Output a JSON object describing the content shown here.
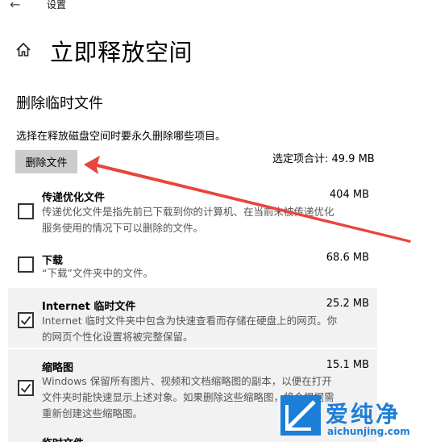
{
  "app": {
    "title": "设置",
    "page_title": "立即释放空间"
  },
  "section": {
    "title": "删除临时文件",
    "description": "选择在释放磁盘空间时要永久删除哪些项目。",
    "delete_button": "删除文件",
    "total_selected": "选定项合计: 49.9 MB"
  },
  "items": [
    {
      "name": "传递优化文件",
      "size": "404 MB",
      "checked": false,
      "desc_line1": "传递优化文件是指先前已下载到你的计算机、在当前未被传递优化",
      "desc_line2": "服务使用的情况下可以删除的文件。"
    },
    {
      "name": "下载",
      "size": "68.6 MB",
      "checked": false,
      "desc_line1": "“下载”文件夹中的文件。"
    },
    {
      "name": "Internet 临时文件",
      "size": "25.2 MB",
      "checked": true,
      "desc_line1": "Internet 临时文件夹中包含为快速查看而存储在硬盘上的网页。你",
      "desc_line2": "的网页个性化设置将被完整保留。"
    },
    {
      "name": "缩略图",
      "size": "15.1 MB",
      "checked": true,
      "desc_line1": "Windows 保留所有图片、视频和文档缩略图的副本，以便在打开",
      "desc_line2": "文件夹时能快速显示上述对象。如果删除这些缩略图，将会根据需",
      "desc_line3": "重新创建这些缩略图。"
    },
    {
      "name": "临时文件"
    }
  ],
  "watermark": {
    "text": "爱纯净",
    "url": "aichunjing.com"
  },
  "colors": {
    "button_bg": "#cccccc",
    "selected_bg": "#f2f2f2",
    "arrow": "#e8453c",
    "brand": "#1c7ed6"
  }
}
